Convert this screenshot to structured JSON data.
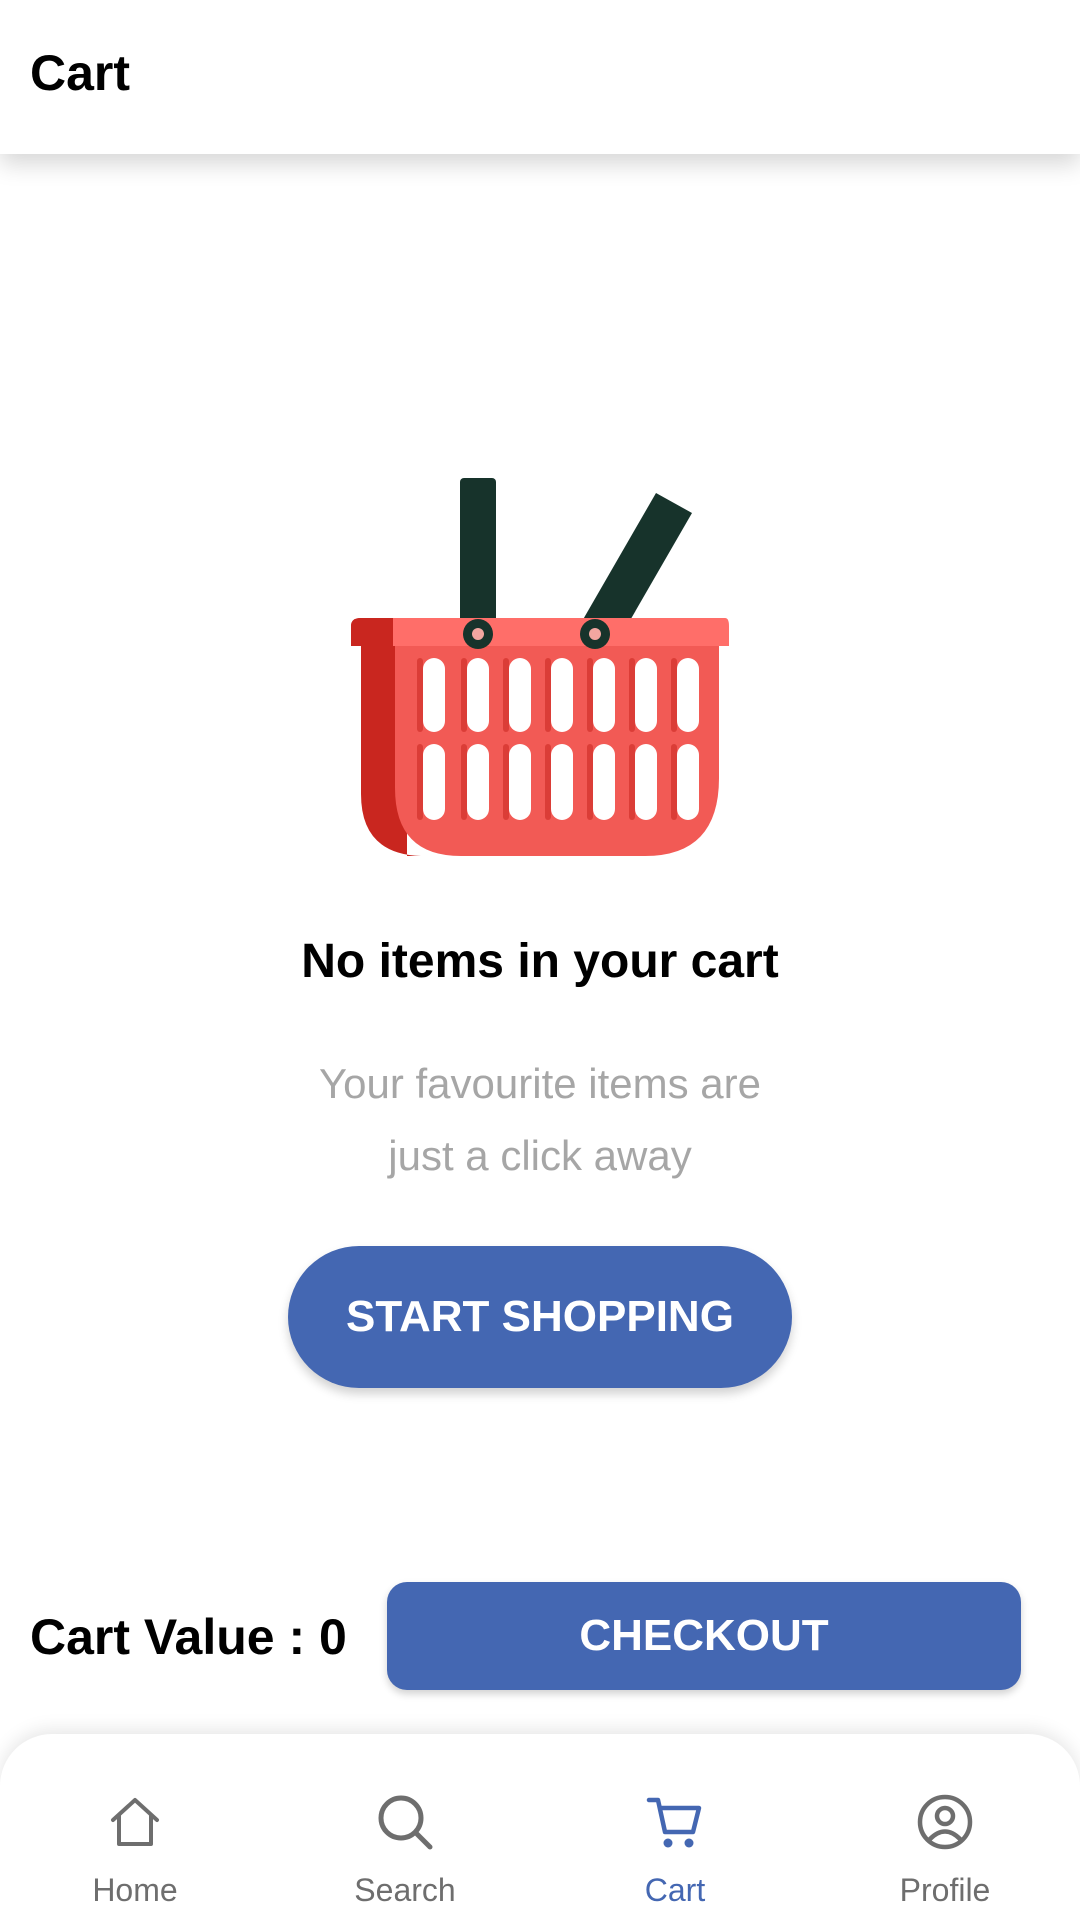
{
  "app_bar": {
    "title": "Cart"
  },
  "empty_state": {
    "illustration": "shopping-basket-illustration",
    "title": "No items in your cart",
    "subtitle_line1": "Your favourite items are",
    "subtitle_line2": "just a click away",
    "button_label": "START SHOPPING"
  },
  "summary": {
    "cart_value_label": "Cart Value : 0",
    "checkout_label": "CHECKOUT"
  },
  "bottom_nav": {
    "items": [
      {
        "label": "Home",
        "icon": "home-icon"
      },
      {
        "label": "Search",
        "icon": "search-icon"
      },
      {
        "label": "Cart",
        "icon": "cart-icon",
        "active": true
      },
      {
        "label": "Profile",
        "icon": "profile-icon"
      }
    ]
  },
  "colors": {
    "accent": "#4467b2",
    "basket_red": "#f0544f",
    "basket_dark_red": "#c9261f",
    "handle": "#17332b",
    "muted_text": "#a6a6a6",
    "nav_inactive": "#6e6e6e"
  }
}
